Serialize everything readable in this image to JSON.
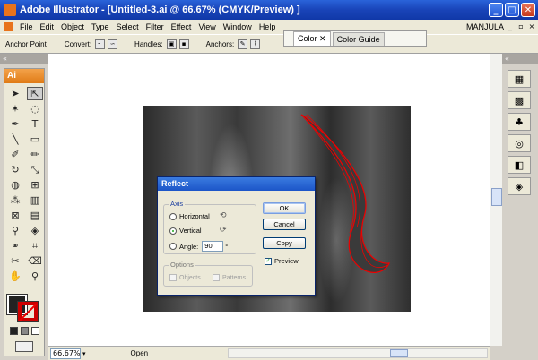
{
  "window": {
    "title": "Adobe Illustrator - [Untitled-3.ai @ 66.67% (CMYK/Preview) ]",
    "minimize": "_",
    "maximize": "□",
    "close": "✕"
  },
  "menu": {
    "items": [
      "File",
      "Edit",
      "Object",
      "Type",
      "Select",
      "Filter",
      "Effect",
      "View",
      "Window",
      "Help"
    ],
    "user": "MANJULA"
  },
  "control_bar": {
    "tool_name": "Anchor Point",
    "convert_label": "Convert:",
    "handles_label": "Handles:",
    "anchors_label": "Anchors:"
  },
  "color_panel": {
    "tabs": [
      "Color",
      "Color Guide"
    ],
    "close": "✕"
  },
  "toolbox": {
    "badge": "Ai"
  },
  "status": {
    "zoom": "66.67%",
    "mode": "Open"
  },
  "reflect_dialog": {
    "title": "Reflect",
    "axis_legend": "Axis",
    "horizontal_label": "Horizontal",
    "vertical_label": "Vertical",
    "angle_label": "Angle:",
    "angle_value": "90",
    "angle_unit": "°",
    "selected_axis": "vertical",
    "ok_label": "OK",
    "cancel_label": "Cancel",
    "copy_label": "Copy",
    "preview_label": "Preview",
    "preview_checked": true,
    "options_legend": "Options",
    "objects_label": "Objects",
    "patterns_label": "Patterns"
  },
  "colors": {
    "titlebar": "#1944b8",
    "accent": "#e07b16",
    "stroke": "#cc0000"
  }
}
